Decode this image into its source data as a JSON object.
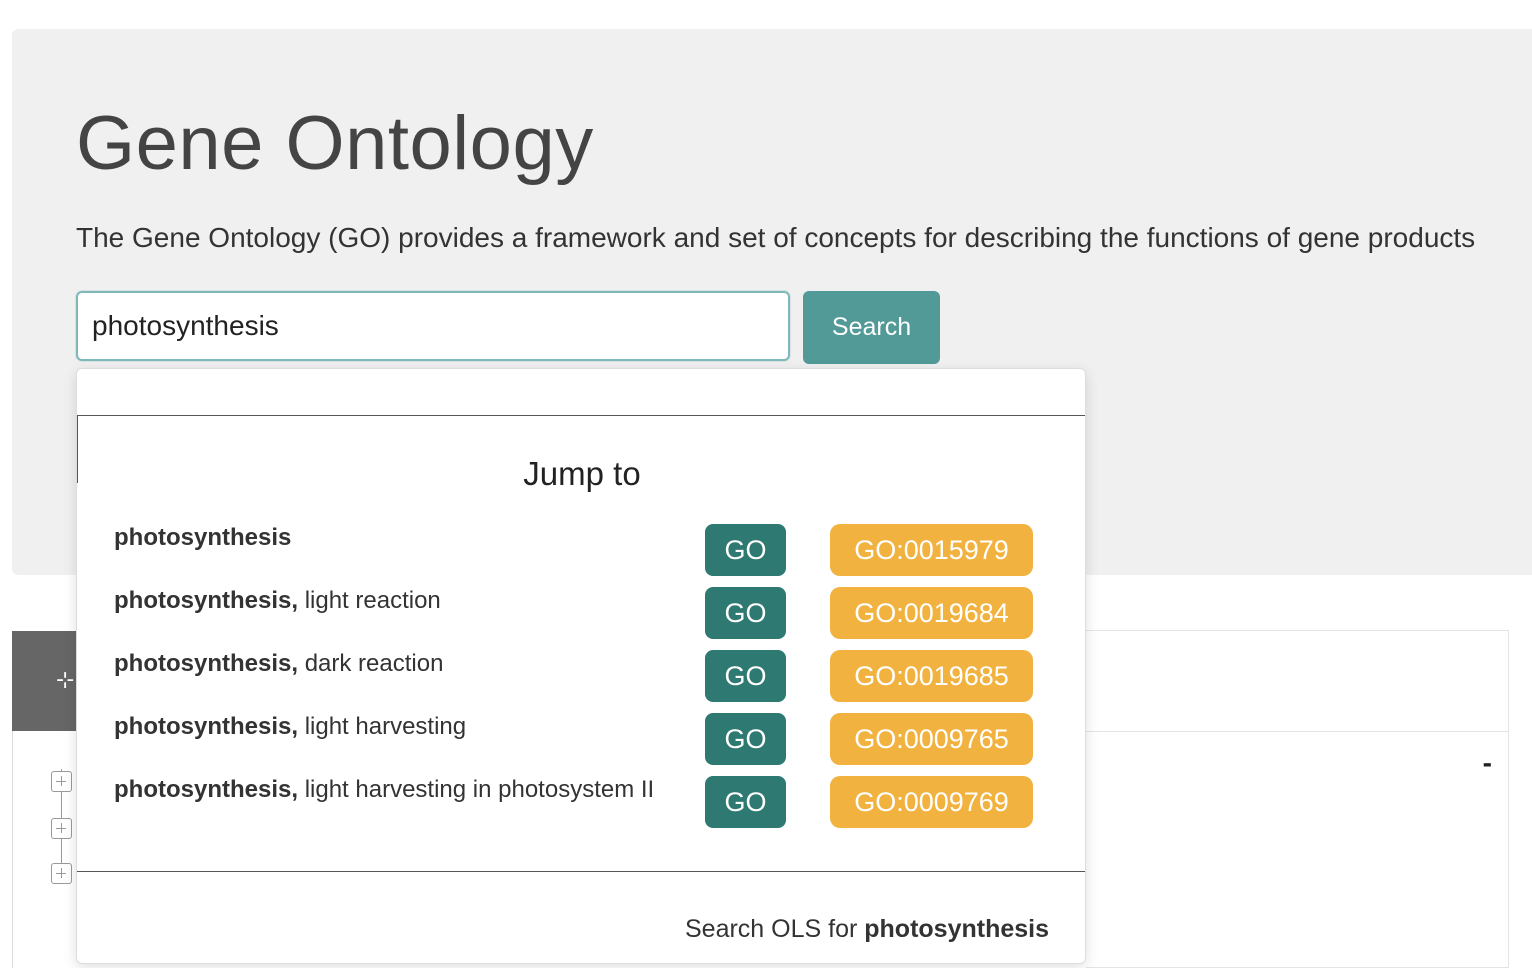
{
  "header": {
    "title": "Gene Ontology",
    "description": "The Gene Ontology (GO) provides a framework and set of concepts for describing the functions of gene products"
  },
  "search": {
    "value": "photosynthesis",
    "button_label": "Search"
  },
  "dropdown": {
    "heading": "Jump to",
    "items": [
      {
        "bold": "photosynthesis",
        "rest": "",
        "ontology": "GO",
        "id": "GO:0015979"
      },
      {
        "bold": "photosynthesis,",
        "rest": " light reaction",
        "ontology": "GO",
        "id": "GO:0019684"
      },
      {
        "bold": "photosynthesis,",
        "rest": " dark reaction",
        "ontology": "GO",
        "id": "GO:0019685"
      },
      {
        "bold": "photosynthesis,",
        "rest": " light harvesting",
        "ontology": "GO",
        "id": "GO:0009765"
      },
      {
        "bold": "photosynthesis,",
        "rest": " light harvesting in photosystem II",
        "ontology": "GO",
        "id": "GO:0009769"
      }
    ],
    "ols_prefix": "Search OLS for ",
    "ols_term": "photosynthesis"
  },
  "background": {
    "collapse_mark": "-"
  },
  "colors": {
    "accent": "#529a97",
    "go_badge": "#2e7a72",
    "id_badge": "#f2b23f",
    "hero_bg": "#f0f0f0"
  },
  "icons": {
    "tree_icon": "tree-icon",
    "expand_icon": "plus-square-icon"
  }
}
